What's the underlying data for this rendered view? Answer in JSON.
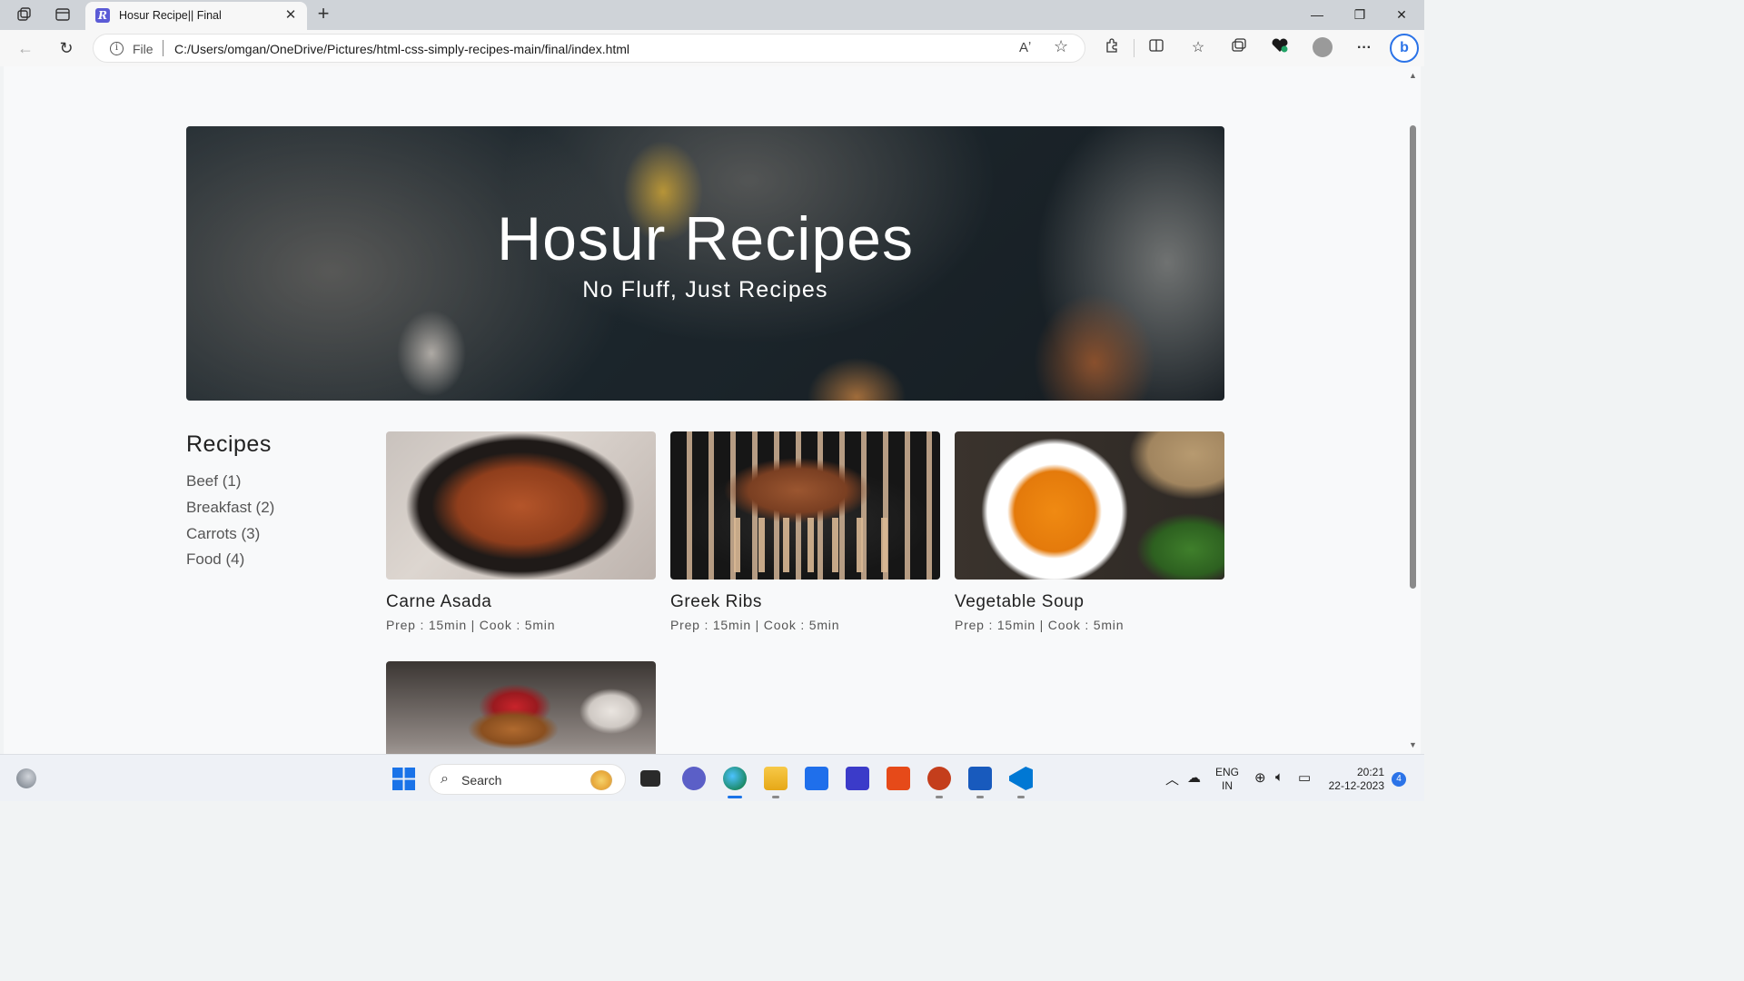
{
  "browser": {
    "tab_title": "Hosur Recipe|| Final",
    "tab_favicon_letter": "R",
    "close_tab_glyph": "✕",
    "new_tab_glyph": "+",
    "window_controls": {
      "minimize": "—",
      "restore": "❐",
      "close": "✕"
    }
  },
  "address_bar": {
    "scheme_label": "File",
    "url": "C:/Users/omgan/OneDrive/Pictures/html-css-simply-recipes-main/final/index.html",
    "info_glyph": "i",
    "read_aloud_glyph": "Aʼ",
    "favorite_glyph": "☆"
  },
  "toolbar_icons": [
    "extensions-icon",
    "split-screen-icon",
    "favorites-icon",
    "collections-icon",
    "browser-essentials-icon",
    "profile-icon",
    "more-icon",
    "copilot-icon"
  ],
  "page": {
    "hero": {
      "title": "Hosur Recipes",
      "subtitle": "No Fluff, Just Recipes"
    },
    "sidebar": {
      "title": "Recipes",
      "tags": [
        {
          "label": "Beef (1)"
        },
        {
          "label": "Breakfast (2)"
        },
        {
          "label": "Carrots (3)"
        },
        {
          "label": "Food (4)"
        }
      ]
    },
    "recipes": [
      {
        "name": "Carne Asada",
        "meta": "Prep : 15min | Cook : 5min"
      },
      {
        "name": "Greek Ribs",
        "meta": "Prep : 15min | Cook : 5min"
      },
      {
        "name": "Vegetable Soup",
        "meta": "Prep : 15min | Cook : 5min"
      },
      {
        "name": "",
        "meta": ""
      }
    ],
    "accent_color": "#5b5bd6"
  },
  "taskbar": {
    "search_placeholder": "Search",
    "language": {
      "line1": "ENG",
      "line2": "IN"
    },
    "time": "20:21",
    "date": "22-12-2023",
    "notification_count": "4"
  }
}
